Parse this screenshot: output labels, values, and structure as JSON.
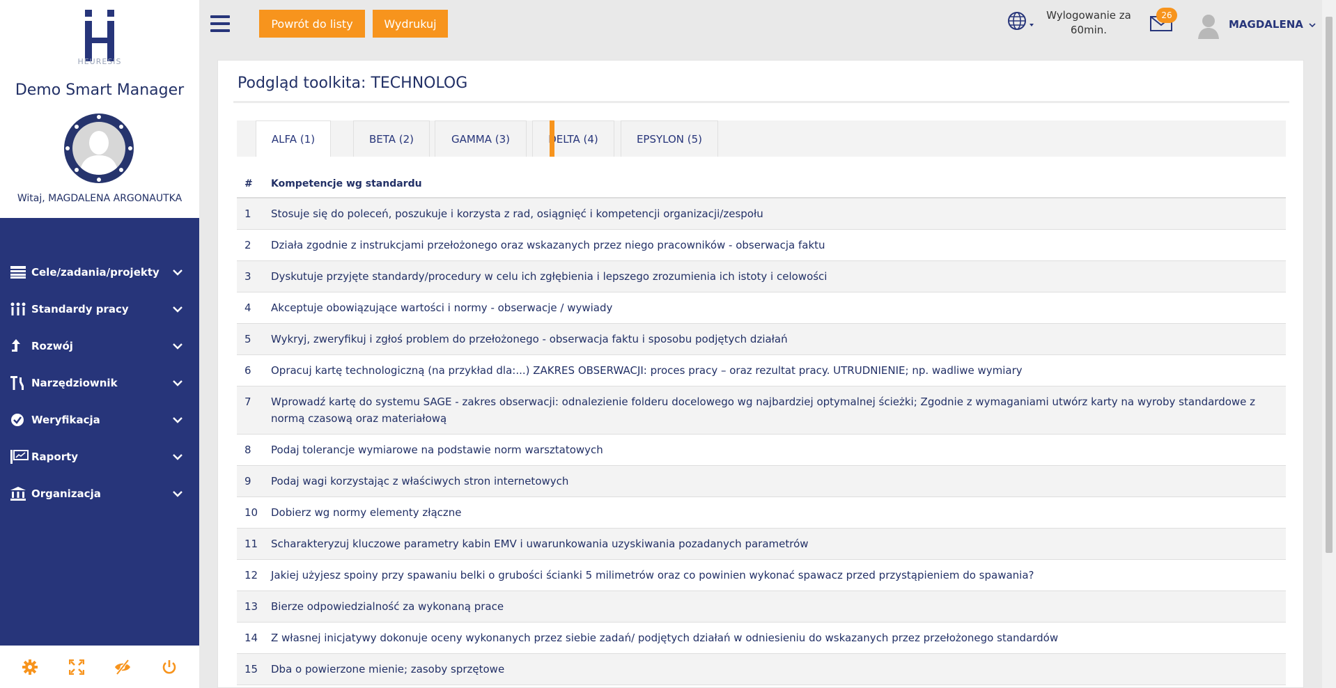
{
  "sidebar": {
    "logo_text": "HEURESIS",
    "app_title": "Demo Smart Manager",
    "welcome": "Witaj, MAGDALENA ARGONAUTKA",
    "nav": [
      {
        "label": "Cele/zadania/projekty",
        "icon": "list-icon"
      },
      {
        "label": "Standardy pracy",
        "icon": "people-icon"
      },
      {
        "label": "Rozwój",
        "icon": "arrow-up-icon"
      },
      {
        "label": "Narzędziownik",
        "icon": "tools-icon"
      },
      {
        "label": "Weryfikacja",
        "icon": "check-circle-icon"
      },
      {
        "label": "Raporty",
        "icon": "presentation-icon"
      },
      {
        "label": "Organizacja",
        "icon": "building-icon"
      }
    ],
    "footer": [
      "gear-icon",
      "fullscreen-icon",
      "eye-slash-icon",
      "power-icon"
    ]
  },
  "topbar": {
    "back_label": "Powrót do listy",
    "print_label": "Wydrukuj",
    "logout_line1": "Wylogowanie za",
    "logout_line2": "60min.",
    "mail_count": "26",
    "user_name": "MAGDALENA"
  },
  "main": {
    "title": "Podgląd toolkita: TECHNOLOG",
    "tabs": [
      "ALFA (1)",
      "BETA (2)",
      "GAMMA (3)",
      "DELTA (4)",
      "EPSYLON (5)"
    ],
    "active_tab": 0,
    "table": {
      "headers": [
        "#",
        "Kompetencje wg standardu"
      ],
      "rows": [
        {
          "n": "1",
          "text": "Stosuje się do poleceń, poszukuje i korzysta z rad, osiągnięć i kompetencji organizacji/zespołu"
        },
        {
          "n": "2",
          "text": "Działa zgodnie z instrukcjami przełożonego oraz wskazanych przez niego pracowników - obserwacja faktu"
        },
        {
          "n": "3",
          "text": "Dyskutuje przyjęte standardy/procedury w celu ich zgłębienia i lepszego zrozumienia ich istoty i celowości"
        },
        {
          "n": "4",
          "text": "Akceptuje obowiązujące wartości i normy - obserwacje / wywiady"
        },
        {
          "n": "5",
          "text": "Wykryj, zweryfikuj i zgłoś problem do przełożonego - obserwacja faktu i sposobu podjętych działań"
        },
        {
          "n": "6",
          "text": "Opracuj kartę technologiczną (na przykład dla:...) ZAKRES OBSERWACJI: proces pracy – oraz rezultat pracy. UTRUDNIENIE; np. wadliwe wymiary"
        },
        {
          "n": "7",
          "text": "Wprowadź kartę do systemu SAGE - zakres obserwacji: odnalezienie folderu docelowego wg najbardziej optymalnej ścieżki; Zgodnie z wymaganiami utwórz karty na wyroby standardowe z normą czasową oraz materiałową"
        },
        {
          "n": "8",
          "text": "Podaj tolerancje wymiarowe na podstawie norm warsztatowych"
        },
        {
          "n": "9",
          "text": "Podaj wagi korzystając z właściwych stron internetowych"
        },
        {
          "n": "10",
          "text": "Dobierz wg normy elementy złączne"
        },
        {
          "n": "11",
          "text": "Scharakteryzuj kluczowe parametry kabin EMV i uwarunkowania uzyskiwania pozadanych parametrów"
        },
        {
          "n": "12",
          "text": "Jakiej użyjesz spoiny przy spawaniu belki o grubości ścianki 5 milimetrów oraz co powinien wykonać spawacz przed przystąpieniem do spawania?"
        },
        {
          "n": "13",
          "text": "Bierze odpowiedzialność za wykonaną prace"
        },
        {
          "n": "14",
          "text": "Z własnej inicjatywy dokonuje oceny wykonanych przez siebie zadań/ podjętych działań w odniesieniu do wskazanych przez przełożonego standardów"
        },
        {
          "n": "15",
          "text": "Dba o powierzone mienie; zasoby sprzętowe"
        }
      ]
    }
  },
  "colors": {
    "nav_bg": "#27357a",
    "accent_orange": "#f7941d",
    "text_navy": "#223066"
  }
}
